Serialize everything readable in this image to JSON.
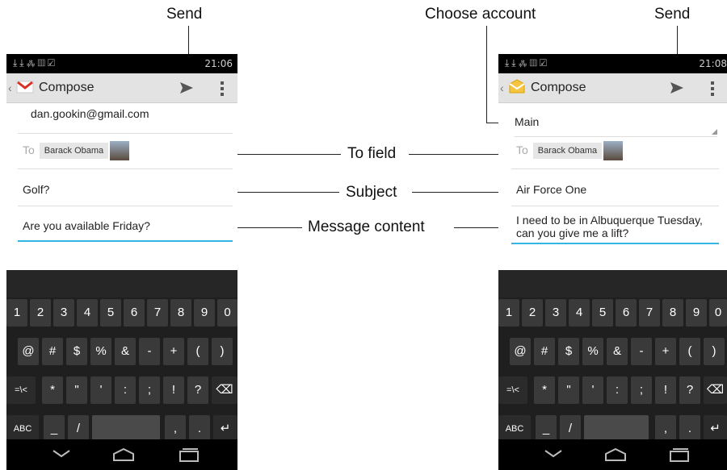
{
  "callouts": {
    "send_left": "Send",
    "choose_account": "Choose account",
    "send_right": "Send",
    "to_field": "To field",
    "subject": "Subject",
    "message_content": "Message content"
  },
  "left_phone": {
    "status_time": "21:06",
    "title": "Compose",
    "from": "dan.gookin@gmail.com",
    "to_label": "To",
    "to_chip": "Barack Obama",
    "subject": "Golf?",
    "message": "Are you available Friday?"
  },
  "right_phone": {
    "status_time": "21:08",
    "title": "Compose",
    "account": "Main",
    "to_label": "To",
    "to_chip": "Barack Obama",
    "subject": "Air Force One",
    "message": "I need to be in Albuquerque Tuesday, can you give me a lift?"
  },
  "keyboard": {
    "row1": [
      "1",
      "2",
      "3",
      "4",
      "5",
      "6",
      "7",
      "8",
      "9",
      "0"
    ],
    "row2": [
      "@",
      "#",
      "$",
      "%",
      "&",
      "-",
      "+",
      "(",
      ")"
    ],
    "row3": [
      "=\\<",
      "*",
      "\"",
      "'",
      ":",
      ";",
      "!",
      "?",
      "⌫"
    ],
    "row4": [
      "ABC",
      "_",
      "/",
      " ",
      ",",
      ".",
      "↵"
    ]
  }
}
